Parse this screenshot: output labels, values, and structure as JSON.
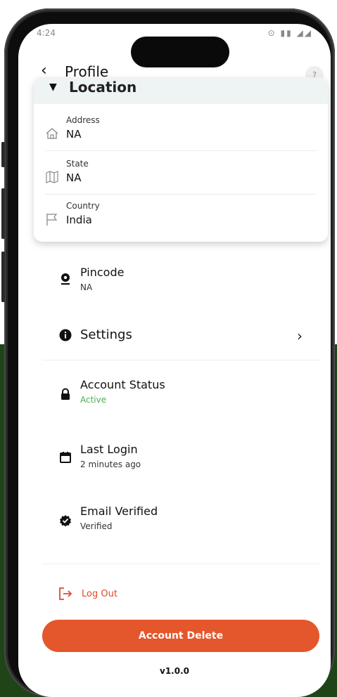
{
  "status_bar": {
    "time": "4:24",
    "icons": "⊙ ▮▮ ◢◢"
  },
  "header": {
    "back_icon": "‹",
    "title": "Profile",
    "help_icon": "?"
  },
  "location": {
    "title": "Location",
    "fields": [
      {
        "label": "Address",
        "value": "NA",
        "icon": "home-icon"
      },
      {
        "label": "State",
        "value": "NA",
        "icon": "map-icon"
      },
      {
        "label": "Country",
        "value": "India",
        "icon": "flag-icon"
      }
    ]
  },
  "pincode": {
    "label": "Pincode",
    "value": "NA"
  },
  "settings": {
    "label": "Settings"
  },
  "account_status": {
    "label": "Account Status",
    "value": "Active",
    "color": "#4caf50"
  },
  "last_login": {
    "label": "Last Login",
    "value": "2 minutes ago"
  },
  "email_verified": {
    "label": "Email Verified",
    "value": "Verified"
  },
  "logout": {
    "label": "Log Out"
  },
  "delete_button": {
    "label": "Account Delete",
    "color": "#e4562b"
  },
  "version": "v1.0.0"
}
